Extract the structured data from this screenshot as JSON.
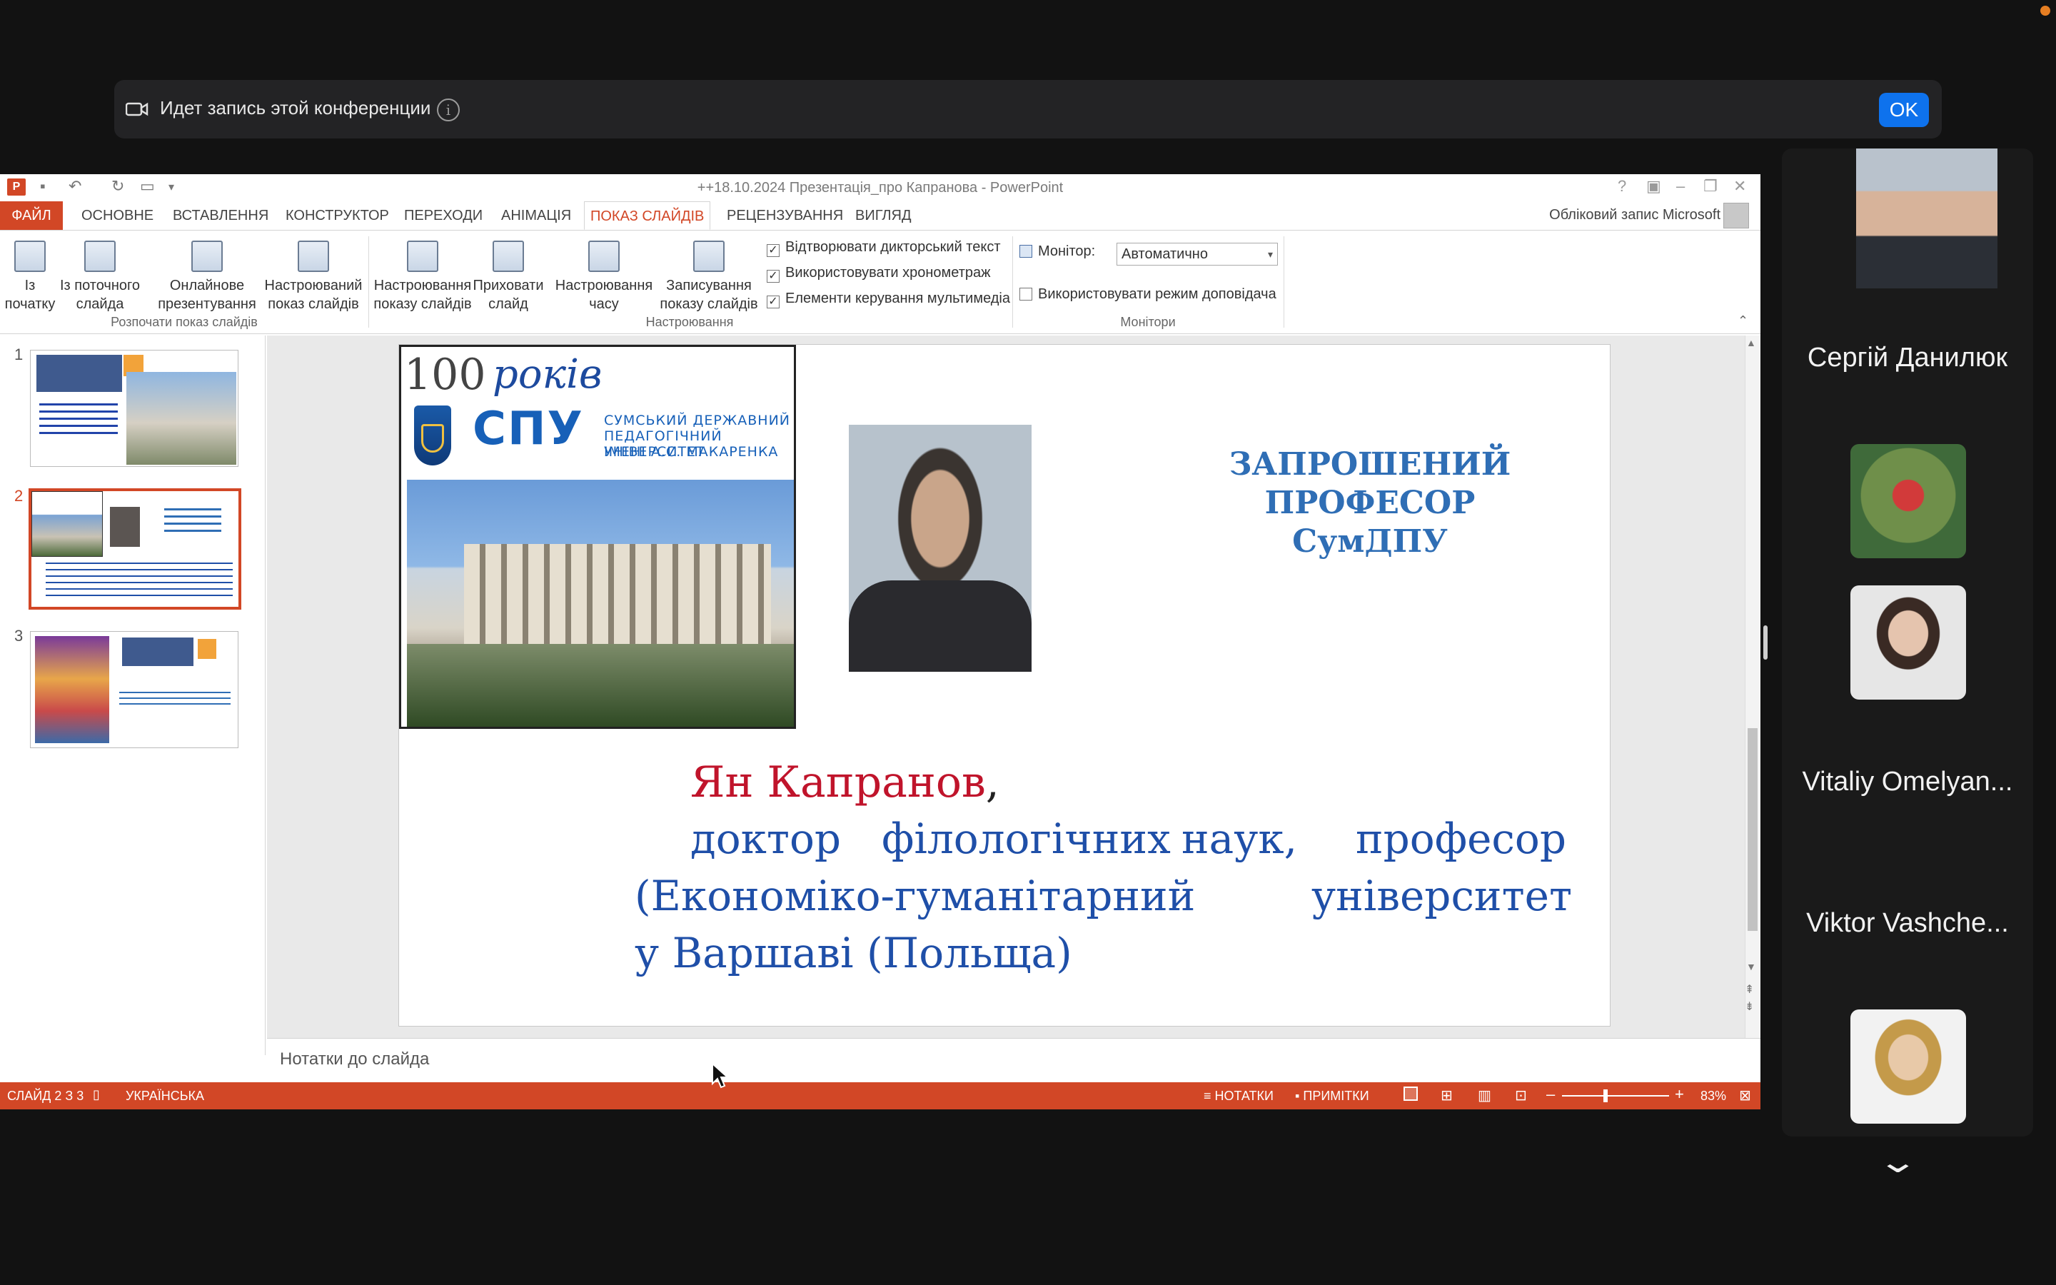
{
  "recording": {
    "text": "Идет запись этой конференции",
    "ok_label": "OK",
    "info_glyph": "i"
  },
  "ppt": {
    "window_title": "++18.10.2024 Презентація_про Капранова - PowerPoint",
    "app_glyph": "P",
    "menu": {
      "file": "ФАЙЛ",
      "tabs": [
        "ОСНОВНЕ",
        "ВСТАВЛЕННЯ",
        "КОНСТРУКТОР",
        "ПЕРЕХОДИ",
        "АНІМАЦІЯ",
        "ПОКАЗ СЛАЙДІВ",
        "РЕЦЕНЗУВАННЯ",
        "ВИГЛЯД"
      ],
      "account": "Обліковий запис Microsoft"
    },
    "ribbon": {
      "start_group": {
        "label": "Розпочати показ слайдів",
        "b1_l1": "Із",
        "b1_l2": "початку",
        "b2_l1": "Із поточного",
        "b2_l2": "слайда",
        "b3_l1": "Онлайнове",
        "b3_l2": "презентування",
        "b4_l1": "Настроюваний",
        "b4_l2": "показ слайдів"
      },
      "setup_group": {
        "label": "Настроювання",
        "b1_l1": "Настроювання",
        "b1_l2": "показу слайдів",
        "b2_l1": "Приховати",
        "b2_l2": "слайд",
        "b3_l1": "Настроювання",
        "b3_l2": "часу",
        "b4_l1": "Записування",
        "b4_l2": "показу слайдів",
        "chk1": "Відтворювати дикторський текст",
        "chk2": "Використовувати хронометраж",
        "chk3": "Елементи керування мультимедіа"
      },
      "monitors_group": {
        "label": "Монітори",
        "monitor_label": "Монітор:",
        "monitor_value": "Автоматично",
        "presenter_view": "Використовувати режим доповідача"
      }
    },
    "slides": [
      "1",
      "2",
      "3"
    ],
    "slide": {
      "years_num": "100",
      "years_word": "років",
      "spu": "СПУ",
      "uni_1": "СУМСЬКИЙ ДЕРЖАВНИЙ",
      "uni_2": "ПЕДАГОГІЧНИЙ УНІВЕРСИТЕТ",
      "uni_3": "ІМЕНІ А.С. МАКАРЕНКА",
      "invite_1": "ЗАПРОШЕНИЙ",
      "invite_2": "ПРОФЕСОР",
      "invite_3": "СумДПУ",
      "name": "Ян Капранов",
      "comma": ",",
      "desc_1a": "доктор",
      "desc_1b": "філологічних",
      "desc_1c": "наук,",
      "desc_1d": "професор",
      "desc_2a": "(Економіко-гуманітарний",
      "desc_2b": "університет",
      "desc_3": "у Варшаві (Польща)"
    },
    "notes_placeholder": "Нотатки до слайда",
    "status": {
      "slide": "СЛАЙД 2 З 3",
      "language": "УКРАЇНСЬКА",
      "notes": "НОТАТКИ",
      "comments": "ПРИМІТКИ",
      "zoom": "83%"
    }
  },
  "participants": [
    {
      "name": "Сергій Данилюк"
    },
    {
      "name": "Vitaliy Omelyan..."
    },
    {
      "name": "Viktor Vashche..."
    }
  ],
  "colors": {
    "ppt_accent": "#d24726",
    "zoom_blue": "#0e72ed",
    "slide_blue": "#2f6eb5",
    "slide_red": "#c0142b"
  },
  "icons": [
    "camera-icon",
    "info-icon",
    "chevron-down-icon",
    "cursor-icon"
  ]
}
